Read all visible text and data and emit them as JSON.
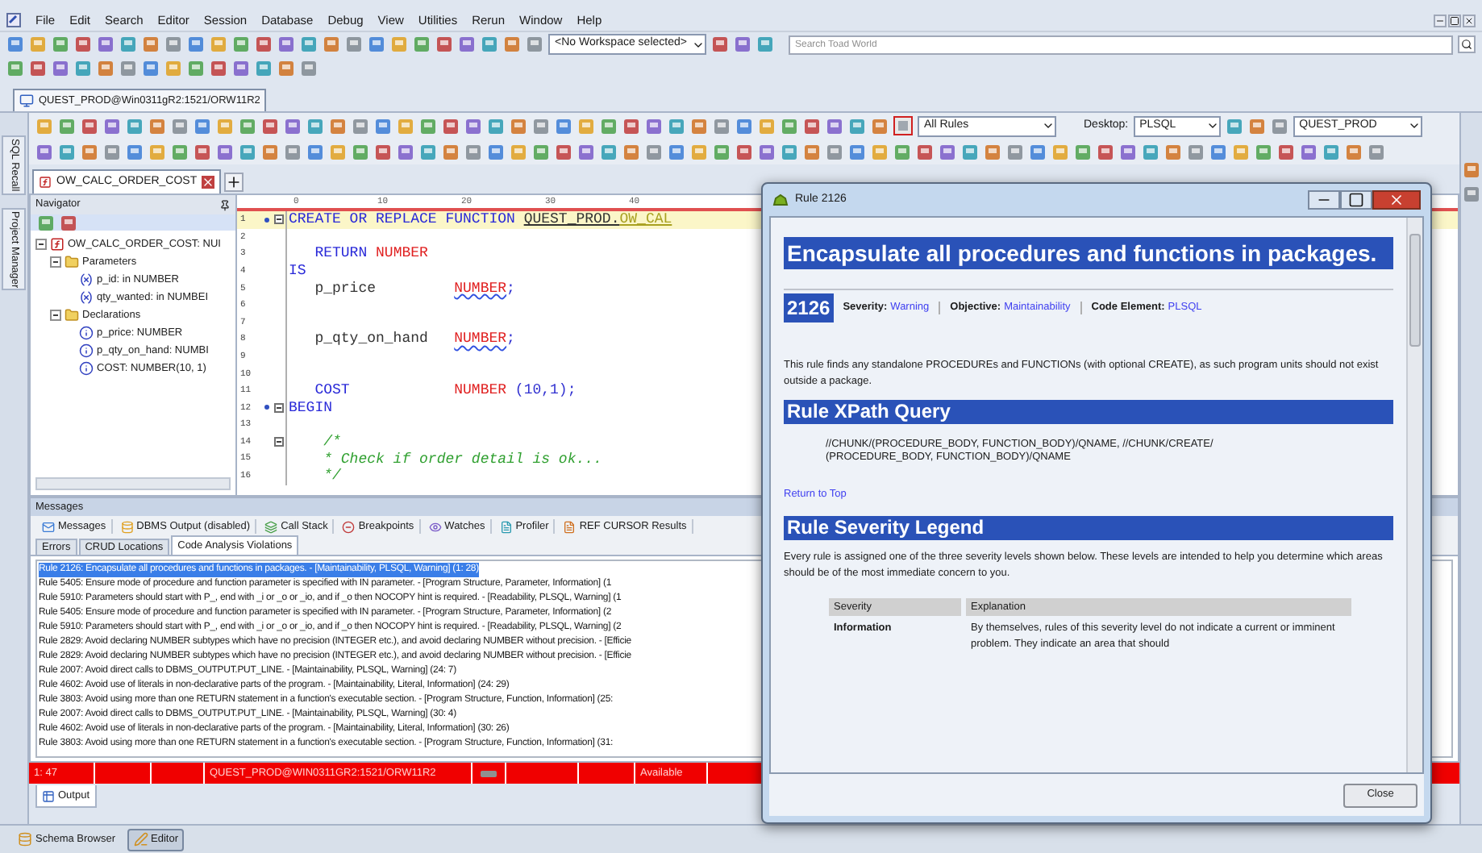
{
  "menu": [
    "File",
    "Edit",
    "Search",
    "Editor",
    "Session",
    "Database",
    "Debug",
    "View",
    "Utilities",
    "Rerun",
    "Window",
    "Help"
  ],
  "toolbar": {
    "workspace": "<No Workspace selected>",
    "search_placeholder": "Search Toad World"
  },
  "connection_tab": {
    "label": "QUEST_PROD@Win0311gR2:1521/ORW11R2",
    "selected": true
  },
  "side_panels": [
    "SQL Recall",
    "Project Manager"
  ],
  "editor_toolbar": {
    "rules": "All Rules",
    "desktop_label": "Desktop:",
    "desktop": "PLSQL",
    "connection": "QUEST_PROD"
  },
  "editor_tabs": [
    {
      "label": "OW_CALC_ORDER_COST",
      "selected": true
    }
  ],
  "navigator": {
    "title": "Navigator",
    "tree": [
      {
        "kind": "function",
        "label": "OW_CALC_ORDER_COST: NUI",
        "expanded": true,
        "children": [
          {
            "kind": "folder",
            "label": "Parameters",
            "expanded": true,
            "children": [
              {
                "kind": "parameter",
                "label": "p_id: in NUMBER"
              },
              {
                "kind": "parameter",
                "label": "qty_wanted: in NUMBEI"
              }
            ]
          },
          {
            "kind": "folder",
            "label": "Declarations",
            "expanded": true,
            "children": [
              {
                "kind": "variable",
                "label": "p_price: NUMBER"
              },
              {
                "kind": "variable",
                "label": "p_qty_on_hand: NUMBI"
              },
              {
                "kind": "variable",
                "label": "COST: NUMBER(10, 1)"
              }
            ]
          }
        ]
      }
    ]
  },
  "ruler": [
    "0",
    "10",
    "20",
    "30",
    "40"
  ],
  "code_lines": [
    {
      "n": "1",
      "marker": true,
      "fold": true,
      "current": true,
      "tokens": [
        {
          "t": "CREATE OR REPLACE FUNCTION ",
          "kind": "keyword"
        },
        {
          "t": "QUEST_PROD.",
          "kind": "object"
        },
        {
          "t": "OW_CAL",
          "kind": "object_name"
        }
      ]
    },
    {
      "n": "2",
      "marker": false,
      "fold": false,
      "current": false
    },
    {
      "n": "3",
      "marker": false,
      "fold": false,
      "current": false,
      "tokens": [
        {
          "t": "   RETURN ",
          "kind": "keyword"
        },
        {
          "t": "NUMBER",
          "kind": "type"
        }
      ]
    },
    {
      "n": "4",
      "marker": false,
      "fold": false,
      "current": false,
      "tokens": [
        {
          "t": "IS",
          "kind": "keyword"
        }
      ]
    },
    {
      "n": "5",
      "marker": false,
      "fold": false,
      "current": false,
      "tokens": [
        {
          "t": "   p_price         ",
          "kind": "ident"
        },
        {
          "t": "NUMBER",
          "kind": "type_error"
        },
        {
          "t": ";",
          "kind": "punct"
        }
      ]
    },
    {
      "n": "6",
      "marker": false,
      "fold": false,
      "current": false
    },
    {
      "n": "7",
      "marker": false,
      "fold": false,
      "current": false
    },
    {
      "n": "8",
      "marker": false,
      "fold": false,
      "current": false,
      "tokens": [
        {
          "t": "   p_qty_on_hand   ",
          "kind": "ident"
        },
        {
          "t": "NUMBER",
          "kind": "type_error"
        },
        {
          "t": ";",
          "kind": "punct"
        }
      ]
    },
    {
      "n": "9",
      "marker": false,
      "fold": false,
      "current": false
    },
    {
      "n": "10",
      "marker": false,
      "fold": false,
      "current": false
    },
    {
      "n": "11",
      "marker": false,
      "fold": false,
      "current": false,
      "tokens": [
        {
          "t": "   COST            ",
          "kind": "keyword"
        },
        {
          "t": "NUMBER",
          "kind": "type"
        },
        {
          "t": " (10,1);",
          "kind": "punct"
        }
      ]
    },
    {
      "n": "12",
      "marker": true,
      "fold": true,
      "current": false,
      "tokens": [
        {
          "t": "BEGIN",
          "kind": "keyword"
        }
      ]
    },
    {
      "n": "13",
      "marker": false,
      "fold": false,
      "current": false
    },
    {
      "n": "14",
      "marker": false,
      "fold": true,
      "current": false,
      "tokens": [
        {
          "t": "    /*",
          "kind": "comment"
        }
      ]
    },
    {
      "n": "15",
      "marker": false,
      "fold": false,
      "current": false,
      "tokens": [
        {
          "t": "    * Check if order detail is ok...",
          "kind": "comment"
        }
      ]
    },
    {
      "n": "16",
      "marker": false,
      "fold": false,
      "current": false,
      "tokens": [
        {
          "t": "    */",
          "kind": "comment"
        }
      ]
    }
  ],
  "messages": {
    "title": "Messages",
    "tabs": [
      "Messages",
      "DBMS Output (disabled)",
      "Call Stack",
      "Breakpoints",
      "Watches",
      "Profiler",
      "REF CURSOR Results"
    ],
    "subtabs": [
      {
        "label": "Errors",
        "selected": false
      },
      {
        "label": "CRUD Locations",
        "selected": false
      },
      {
        "label": "Code Analysis Violations",
        "selected": true
      }
    ],
    "violations": [
      {
        "text": "Rule 2126: Encapsulate all procedures and functions in packages. - [Maintainability, PLSQL, Warning] (1: 28)",
        "selected": true
      },
      {
        "text": "Rule 5405: Ensure mode of procedure and function parameter is specified with IN parameter. - [Program Structure, Parameter, Information] (1",
        "selected": false
      },
      {
        "text": "Rule 5910: Parameters should start with P_, end with _i or _o or _io, and if _o then NOCOPY hint is required. - [Readability, PLSQL, Warning] (1",
        "selected": false
      },
      {
        "text": "Rule 5405: Ensure mode of procedure and function parameter is specified with IN parameter. - [Program Structure, Parameter, Information] (2",
        "selected": false
      },
      {
        "text": "Rule 5910: Parameters should start with P_, end with _i or _o or _io, and if _o then NOCOPY hint is required. - [Readability, PLSQL, Warning] (2",
        "selected": false
      },
      {
        "text": "Rule 2829: Avoid declaring NUMBER subtypes which have no precision (INTEGER etc.), and avoid declaring NUMBER without precision. - [Efficie",
        "selected": false
      },
      {
        "text": "Rule 2829: Avoid declaring NUMBER subtypes which have no precision (INTEGER etc.), and avoid declaring NUMBER without precision. - [Efficie",
        "selected": false
      },
      {
        "text": "Rule 2007: Avoid direct calls to DBMS_OUTPUT.PUT_LINE. - [Maintainability, PLSQL, Warning] (24: 7)",
        "selected": false
      },
      {
        "text": "Rule 4602: Avoid use of literals in non-declarative parts of the program. - [Maintainability, Literal, Information] (24: 29)",
        "selected": false
      },
      {
        "text": "Rule 3803: Avoid using more than one RETURN statement in a function's executable section. - [Program Structure, Function, Information] (25:",
        "selected": false
      },
      {
        "text": "Rule 2007: Avoid direct calls to DBMS_OUTPUT.PUT_LINE. - [Maintainability, PLSQL, Warning] (30: 4)",
        "selected": false
      },
      {
        "text": "Rule 4602: Avoid use of literals in non-declarative parts of the program. - [Maintainability, Literal, Information] (30: 26)",
        "selected": false
      },
      {
        "text": "Rule 3803: Avoid using more than one RETURN statement in a function's executable section. - [Program Structure, Function, Information] (31:",
        "selected": false
      }
    ]
  },
  "status_bar": [
    {
      "kind": "text",
      "text": "1: 47"
    },
    {
      "kind": "empty"
    },
    {
      "kind": "empty"
    },
    {
      "kind": "text",
      "text": "QUEST_PROD@WIN0311GR2:1521/ORW11R2"
    },
    {
      "kind": "icon"
    },
    {
      "kind": "empty"
    },
    {
      "kind": "empty"
    },
    {
      "kind": "text",
      "text": "Available"
    },
    {
      "kind": "empty"
    }
  ],
  "bottom_tabs": [
    {
      "label": "Output"
    }
  ],
  "taskbar": [
    {
      "label": "Schema Browser",
      "selected": false
    },
    {
      "label": "Editor",
      "selected": true
    }
  ],
  "dialog": {
    "title": "Rule 2126",
    "heading": "Encapsulate all procedures and functions in packages.",
    "rule_id": "2126",
    "meta": [
      {
        "label": "Severity:",
        "value": "Warning"
      },
      {
        "label": "Objective:",
        "value": "Maintainability"
      },
      {
        "label": "Code Element:",
        "value": "PLSQL"
      }
    ],
    "description": "This rule finds any standalone PROCEDUREs and FUNCTIONs (with optional CREATE), as such program units should not exist outside a package.",
    "xpath_heading": "Rule XPath Query",
    "xpath": [
      "//CHUNK/(PROCEDURE_BODY, FUNCTION_BODY)/QNAME, //CHUNK/CREATE/",
      "(PROCEDURE_BODY, FUNCTION_BODY)/QNAME"
    ],
    "return_link": "Return to Top",
    "legend_heading": "Rule Severity Legend",
    "legend_text": "Every rule is assigned one of the three severity levels shown below. These levels are intended to help you determine which areas should be of the most immediate concern to you.",
    "table": {
      "columns": [
        "Severity",
        "Explanation"
      ],
      "rows": [
        [
          "Information",
          "By themselves, rules of this severity level do not indicate a current or imminent problem. They indicate an area that should"
        ]
      ]
    },
    "close": "Close"
  }
}
